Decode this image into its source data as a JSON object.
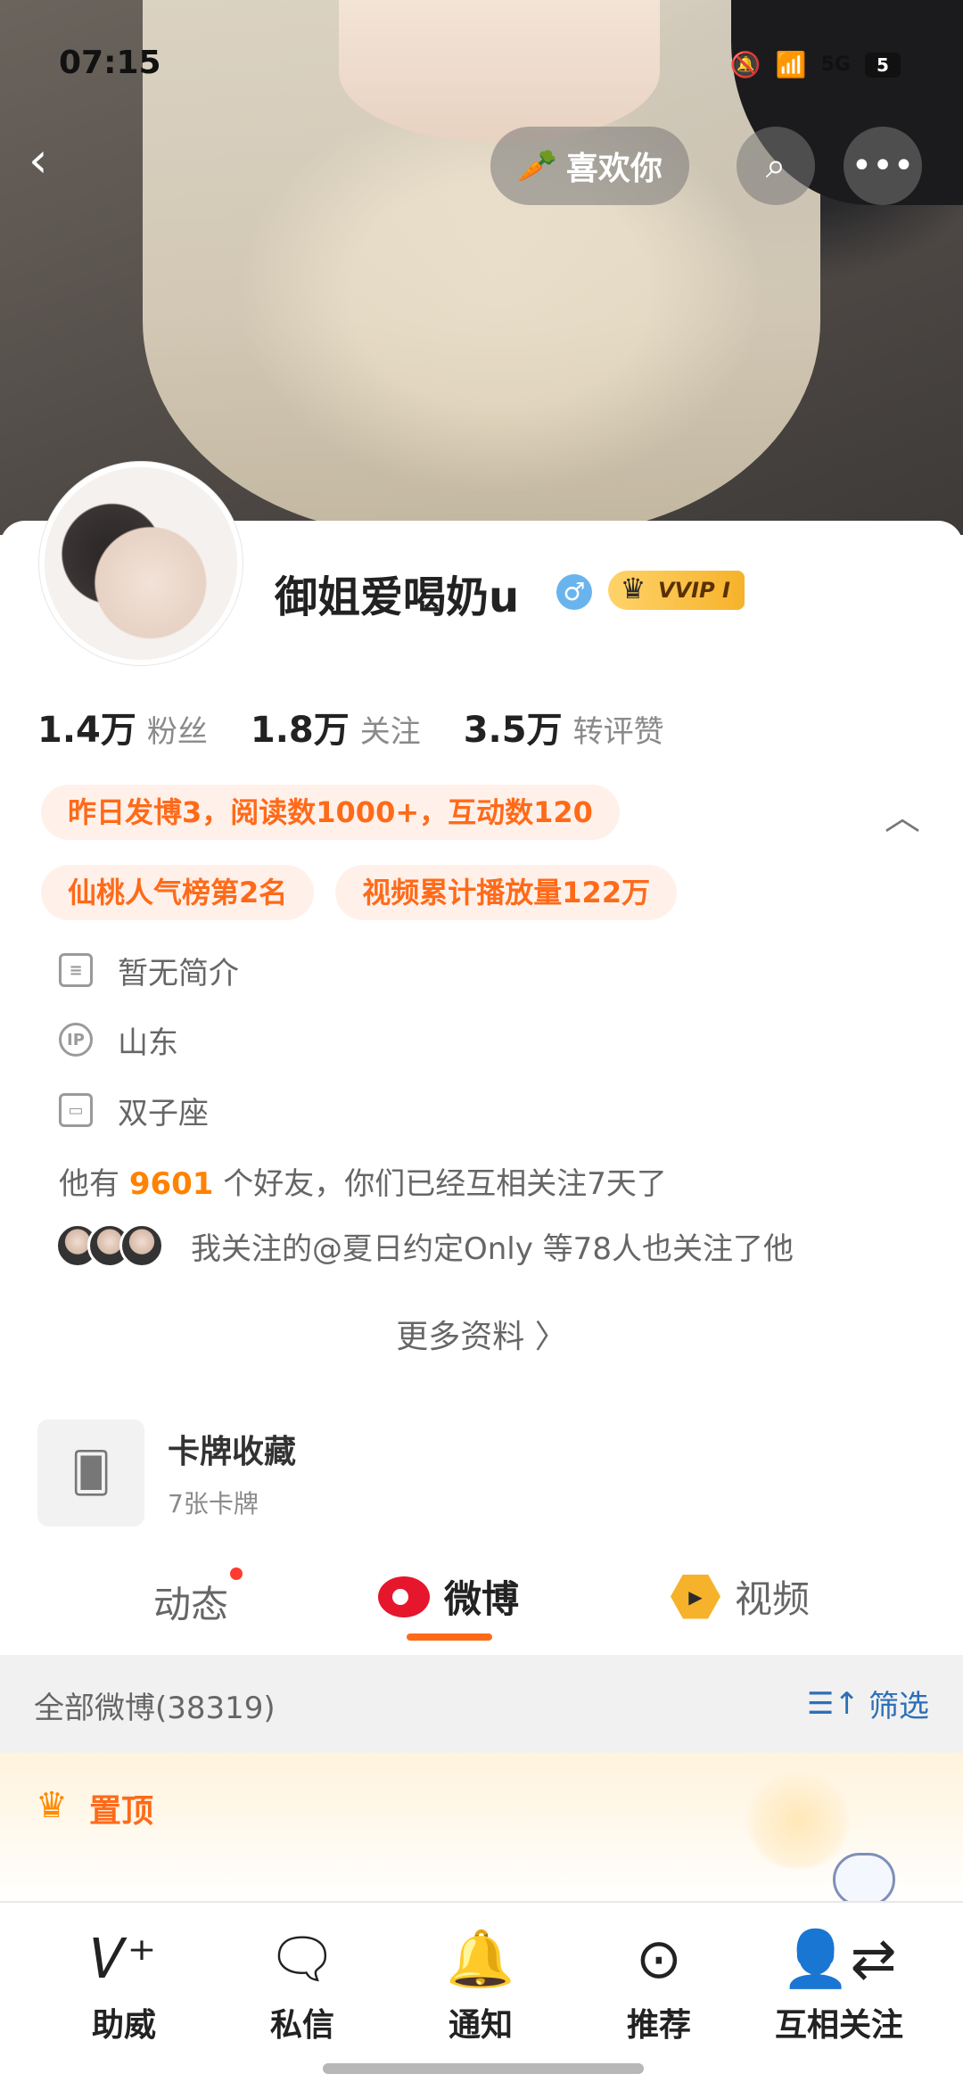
{
  "status_bar": {
    "time": "07:15",
    "network": "5G",
    "battery": "5"
  },
  "header": {
    "like_label": "喜欢你",
    "back_icon": "chevron-left-icon",
    "search_icon": "search-icon",
    "more_icon": "more-icon"
  },
  "profile": {
    "name": "御姐爱喝奶u",
    "vip_badge": "VVIP I",
    "stats": [
      {
        "num": "1.4万",
        "label": "粉丝"
      },
      {
        "num": "1.8万",
        "label": "关注"
      },
      {
        "num": "3.5万",
        "label": "转评赞"
      }
    ],
    "tags_row1": [
      "昨日发博3，阅读数1000+，互动数120"
    ],
    "tags_row2": [
      "仙桃人气榜第2名",
      "视频累计播放量122万"
    ],
    "bio": "暂无简介",
    "ip": "山东",
    "zodiac": "双子座",
    "friends_prefix": "他有",
    "friends_count": "9601",
    "friends_suffix": "个好友，你们已经互相关注7天了",
    "mutual_text": "我关注的@夏日约定Only 等78人也关注了他",
    "more_info": "更多资料 〉",
    "card_collection": {
      "title": "卡牌收藏",
      "subtitle": "7张卡牌"
    }
  },
  "tabs": {
    "dongtai": "动态",
    "weibo": "微博",
    "video": "视频"
  },
  "feed": {
    "all_label": "全部微博(38319)",
    "filter_label": "筛选",
    "pinned_label": "置顶"
  },
  "bottom_nav": [
    {
      "label": "助威",
      "icon": "v-plus-icon"
    },
    {
      "label": "私信",
      "icon": "chat-icon"
    },
    {
      "label": "通知",
      "icon": "bell-plus-icon"
    },
    {
      "label": "推荐",
      "icon": "chevron-up-circle-icon"
    },
    {
      "label": "互相关注",
      "icon": "mutual-follow-icon"
    }
  ]
}
